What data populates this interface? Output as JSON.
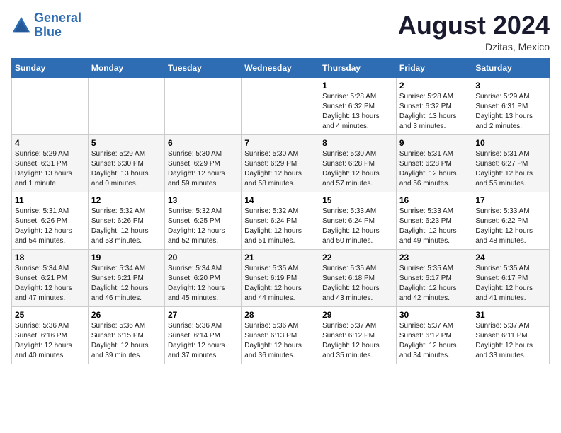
{
  "logo": {
    "line1": "General",
    "line2": "Blue"
  },
  "title": "August 2024",
  "location": "Dzitas, Mexico",
  "days_of_week": [
    "Sunday",
    "Monday",
    "Tuesday",
    "Wednesday",
    "Thursday",
    "Friday",
    "Saturday"
  ],
  "weeks": [
    [
      {
        "day": "",
        "info": ""
      },
      {
        "day": "",
        "info": ""
      },
      {
        "day": "",
        "info": ""
      },
      {
        "day": "",
        "info": ""
      },
      {
        "day": "1",
        "info": "Sunrise: 5:28 AM\nSunset: 6:32 PM\nDaylight: 13 hours\nand 4 minutes."
      },
      {
        "day": "2",
        "info": "Sunrise: 5:28 AM\nSunset: 6:32 PM\nDaylight: 13 hours\nand 3 minutes."
      },
      {
        "day": "3",
        "info": "Sunrise: 5:29 AM\nSunset: 6:31 PM\nDaylight: 13 hours\nand 2 minutes."
      }
    ],
    [
      {
        "day": "4",
        "info": "Sunrise: 5:29 AM\nSunset: 6:31 PM\nDaylight: 13 hours\nand 1 minute."
      },
      {
        "day": "5",
        "info": "Sunrise: 5:29 AM\nSunset: 6:30 PM\nDaylight: 13 hours\nand 0 minutes."
      },
      {
        "day": "6",
        "info": "Sunrise: 5:30 AM\nSunset: 6:29 PM\nDaylight: 12 hours\nand 59 minutes."
      },
      {
        "day": "7",
        "info": "Sunrise: 5:30 AM\nSunset: 6:29 PM\nDaylight: 12 hours\nand 58 minutes."
      },
      {
        "day": "8",
        "info": "Sunrise: 5:30 AM\nSunset: 6:28 PM\nDaylight: 12 hours\nand 57 minutes."
      },
      {
        "day": "9",
        "info": "Sunrise: 5:31 AM\nSunset: 6:28 PM\nDaylight: 12 hours\nand 56 minutes."
      },
      {
        "day": "10",
        "info": "Sunrise: 5:31 AM\nSunset: 6:27 PM\nDaylight: 12 hours\nand 55 minutes."
      }
    ],
    [
      {
        "day": "11",
        "info": "Sunrise: 5:31 AM\nSunset: 6:26 PM\nDaylight: 12 hours\nand 54 minutes."
      },
      {
        "day": "12",
        "info": "Sunrise: 5:32 AM\nSunset: 6:26 PM\nDaylight: 12 hours\nand 53 minutes."
      },
      {
        "day": "13",
        "info": "Sunrise: 5:32 AM\nSunset: 6:25 PM\nDaylight: 12 hours\nand 52 minutes."
      },
      {
        "day": "14",
        "info": "Sunrise: 5:32 AM\nSunset: 6:24 PM\nDaylight: 12 hours\nand 51 minutes."
      },
      {
        "day": "15",
        "info": "Sunrise: 5:33 AM\nSunset: 6:24 PM\nDaylight: 12 hours\nand 50 minutes."
      },
      {
        "day": "16",
        "info": "Sunrise: 5:33 AM\nSunset: 6:23 PM\nDaylight: 12 hours\nand 49 minutes."
      },
      {
        "day": "17",
        "info": "Sunrise: 5:33 AM\nSunset: 6:22 PM\nDaylight: 12 hours\nand 48 minutes."
      }
    ],
    [
      {
        "day": "18",
        "info": "Sunrise: 5:34 AM\nSunset: 6:21 PM\nDaylight: 12 hours\nand 47 minutes."
      },
      {
        "day": "19",
        "info": "Sunrise: 5:34 AM\nSunset: 6:21 PM\nDaylight: 12 hours\nand 46 minutes."
      },
      {
        "day": "20",
        "info": "Sunrise: 5:34 AM\nSunset: 6:20 PM\nDaylight: 12 hours\nand 45 minutes."
      },
      {
        "day": "21",
        "info": "Sunrise: 5:35 AM\nSunset: 6:19 PM\nDaylight: 12 hours\nand 44 minutes."
      },
      {
        "day": "22",
        "info": "Sunrise: 5:35 AM\nSunset: 6:18 PM\nDaylight: 12 hours\nand 43 minutes."
      },
      {
        "day": "23",
        "info": "Sunrise: 5:35 AM\nSunset: 6:17 PM\nDaylight: 12 hours\nand 42 minutes."
      },
      {
        "day": "24",
        "info": "Sunrise: 5:35 AM\nSunset: 6:17 PM\nDaylight: 12 hours\nand 41 minutes."
      }
    ],
    [
      {
        "day": "25",
        "info": "Sunrise: 5:36 AM\nSunset: 6:16 PM\nDaylight: 12 hours\nand 40 minutes."
      },
      {
        "day": "26",
        "info": "Sunrise: 5:36 AM\nSunset: 6:15 PM\nDaylight: 12 hours\nand 39 minutes."
      },
      {
        "day": "27",
        "info": "Sunrise: 5:36 AM\nSunset: 6:14 PM\nDaylight: 12 hours\nand 37 minutes."
      },
      {
        "day": "28",
        "info": "Sunrise: 5:36 AM\nSunset: 6:13 PM\nDaylight: 12 hours\nand 36 minutes."
      },
      {
        "day": "29",
        "info": "Sunrise: 5:37 AM\nSunset: 6:12 PM\nDaylight: 12 hours\nand 35 minutes."
      },
      {
        "day": "30",
        "info": "Sunrise: 5:37 AM\nSunset: 6:12 PM\nDaylight: 12 hours\nand 34 minutes."
      },
      {
        "day": "31",
        "info": "Sunrise: 5:37 AM\nSunset: 6:11 PM\nDaylight: 12 hours\nand 33 minutes."
      }
    ]
  ]
}
